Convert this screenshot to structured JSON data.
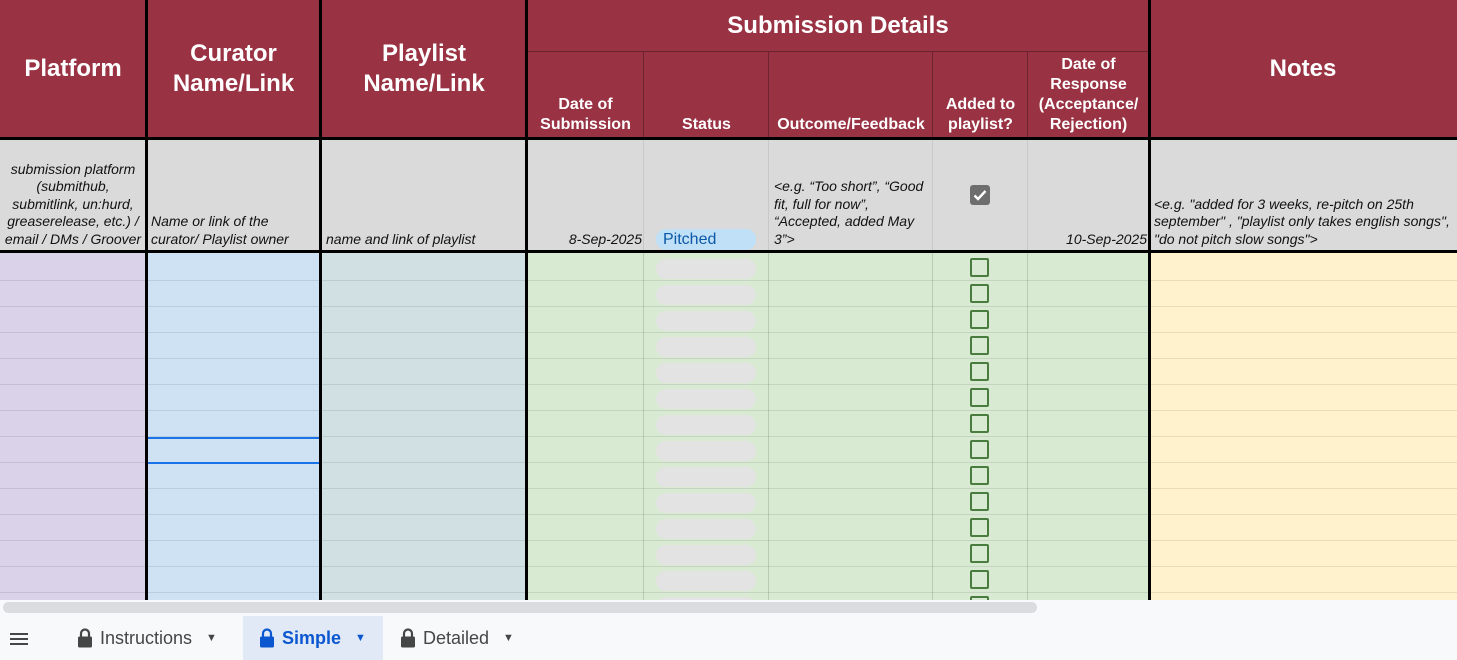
{
  "header": {
    "platform": "Platform",
    "curator": "Curator Name/Link",
    "playlist": "Playlist Name/Link",
    "submission_details": "Submission Details",
    "date_of_submission": "Date of Submission",
    "status": "Status",
    "outcome": "Outcome/Feedback",
    "added": "Added to playlist?",
    "date_of_response": "Date of Response (Acceptance/ Rejection)",
    "notes": "Notes"
  },
  "example_row": {
    "platform": "submission platform (submithub, submitlink, un:hurd, greaserelease, etc.) / email / DMs / Groover",
    "curator": "Name or link of the curator/ Playlist owner",
    "playlist": "name and link of playlist",
    "date_of_submission": "8-Sep-2025",
    "status": "Pitched",
    "outcome": "<e.g. “Too short”, “Good fit, full for now”, “Accepted, added May 3”>",
    "added": true,
    "date_of_response": "10-Sep-2025",
    "notes": "<e.g. \"added for 3 weeks, re-pitch on 25th september\" , \"playlist only takes english songs\", \"do not pitch slow songs\">"
  },
  "colors": {
    "header": "#993344",
    "platform_col": "#d9d2e9",
    "curator_col": "#cfe2f3",
    "playlist_col": "#d0e0e3",
    "submission_col": "#d9ead3",
    "notes_col": "#fff2cc",
    "example_row": "#dadada",
    "status_pill": "#bfe0f6",
    "checkbox": "#4a7c3f"
  },
  "empty_rows": 14,
  "tabs": [
    {
      "label": "Instructions",
      "locked": true,
      "active": false
    },
    {
      "label": "Simple",
      "locked": true,
      "active": true
    },
    {
      "label": "Detailed",
      "locked": true,
      "active": false
    }
  ],
  "icons": {
    "menu": "all-sheets-menu-icon",
    "lock": "lock-icon",
    "caret": "chevron-down-icon",
    "check": "check-icon"
  }
}
